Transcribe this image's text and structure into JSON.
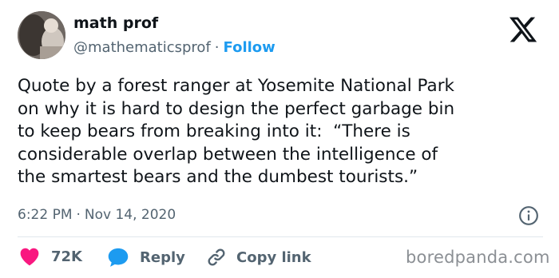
{
  "author": {
    "name": "math prof",
    "handle": "@mathematicsprof",
    "separator": "·",
    "follow_label": "Follow"
  },
  "tweet": {
    "text": "Quote by a forest ranger at Yosemite National Park\non why it is hard to design the perfect garbage bin\nto keep bears from breaking into it:  “There is\nconsiderable overlap between the intelligence of\nthe smartest bears and the dumbest tourists.”",
    "time": "6:22 PM",
    "separator": "·",
    "date": "Nov 14, 2020"
  },
  "actions": {
    "like_count": "72K",
    "reply_label": "Reply",
    "copy_link_label": "Copy link"
  },
  "watermark": "boredpanda.com",
  "icons": {
    "x_logo": "x-logo-icon",
    "info": "info-icon",
    "heart": "heart-icon",
    "reply": "speech-bubble-icon",
    "link": "link-icon"
  },
  "colors": {
    "accent": "#1d9bf0",
    "like": "#f91880",
    "text": "#0f1419",
    "muted": "#536471"
  }
}
